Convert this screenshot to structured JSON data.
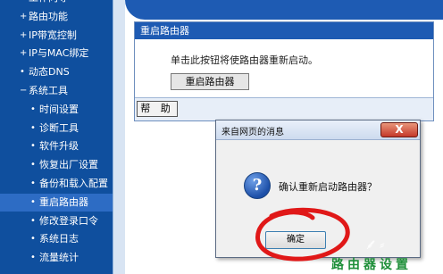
{
  "sidebar": {
    "items": [
      {
        "label": "工作向导",
        "bullet": "+",
        "indent": "top"
      },
      {
        "label": "路由功能",
        "bullet": "+",
        "indent": "top"
      },
      {
        "label": "IP带宽控制",
        "bullet": "+",
        "indent": "top"
      },
      {
        "label": "IP与MAC绑定",
        "bullet": "+",
        "indent": "top"
      },
      {
        "label": "动态DNS",
        "bullet": "•",
        "indent": "top"
      },
      {
        "label": "系统工具",
        "bullet": "−",
        "indent": "top"
      },
      {
        "label": "时间设置",
        "bullet": "•",
        "indent": "sub"
      },
      {
        "label": "诊断工具",
        "bullet": "•",
        "indent": "sub"
      },
      {
        "label": "软件升级",
        "bullet": "•",
        "indent": "sub"
      },
      {
        "label": "恢复出厂设置",
        "bullet": "•",
        "indent": "sub"
      },
      {
        "label": "备份和载入配置",
        "bullet": "•",
        "indent": "sub"
      },
      {
        "label": "重启路由器",
        "bullet": "•",
        "indent": "sub",
        "selected": true
      },
      {
        "label": "修改登录口令",
        "bullet": "•",
        "indent": "sub"
      },
      {
        "label": "系统日志",
        "bullet": "•",
        "indent": "sub"
      },
      {
        "label": "流量统计",
        "bullet": "•",
        "indent": "sub"
      }
    ]
  },
  "panel": {
    "title": "重启路由器",
    "description": "单击此按钮将使路由器重新启动。",
    "reboot_button": "重启路由器",
    "help_button": "帮 助"
  },
  "dialog": {
    "title": "来自网页的消息",
    "close_label": "X",
    "icon": "question-icon",
    "icon_glyph": "?",
    "message": "确认重新启动路由器？",
    "ok_button": "确定"
  },
  "watermark": "路由器设置",
  "colors": {
    "sidebar_bg": "#0f4f9e",
    "header_blue": "#1e5bb3",
    "annotation_red": "#e01818",
    "watermark_green": "#1f8f3a"
  }
}
